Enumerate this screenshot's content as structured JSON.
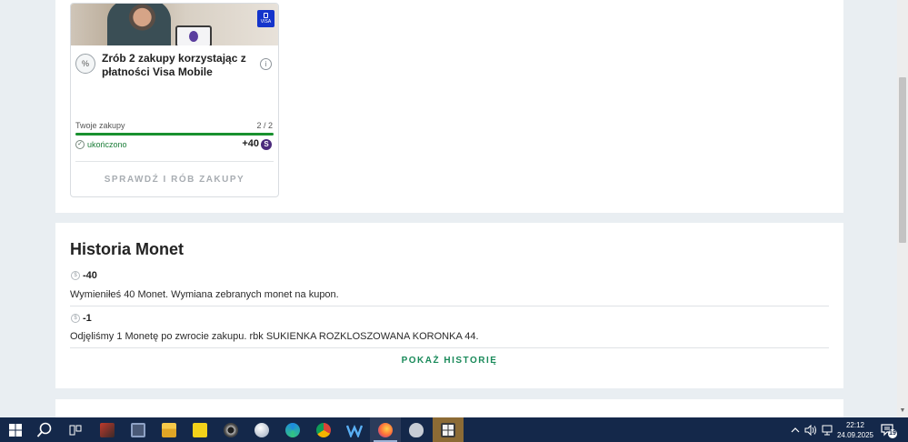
{
  "offer_card": {
    "title": "Zrób 2 zakupy korzystając z płatności Visa Mobile",
    "badge_text": "VISA",
    "percent_icon": "%",
    "info_icon": "i",
    "progress_label": "Twoje zakupy",
    "progress_count": "2 / 2",
    "progress_fraction": 1.0,
    "status_text": "ukończono",
    "reward": "+40",
    "coin_symbol": "S",
    "cta_label": "SPRAWDŹ I RÓB ZAKUPY",
    "colors": {
      "progress": "#19912f",
      "status": "#1b7d38",
      "coin": "#4b2a7c",
      "visa": "#1434cb"
    }
  },
  "history": {
    "title": "Historia Monet",
    "entries": [
      {
        "amount": "-40",
        "description": "Wymieniłeś 40 Monet. Wymiana zebranych monet na kupon."
      },
      {
        "amount": "-1",
        "description": "Odjęliśmy 1 Monetę po zwrocie zakupu. rbk SUKIENKA ROZKLOSZOWANA KORONKA 44."
      }
    ],
    "more_label": "POKAŻ HISTORIĘ",
    "colors": {
      "more": "#1a8a5a"
    }
  },
  "taskbar": {
    "apps": [
      {
        "name": "task-view-icon"
      },
      {
        "name": "app-icon-red"
      },
      {
        "name": "calculator-icon"
      },
      {
        "name": "file-explorer-icon"
      },
      {
        "name": "sticky-notes-icon"
      },
      {
        "name": "settings-icon"
      },
      {
        "name": "app-icon-sphere"
      },
      {
        "name": "edge-icon"
      },
      {
        "name": "chrome-icon"
      },
      {
        "name": "wps-icon"
      },
      {
        "name": "firefox-icon"
      },
      {
        "name": "app-icon-shield"
      },
      {
        "name": "app-icon-crest"
      }
    ],
    "time": "22:12",
    "date": "24.09.2025",
    "notification_count": "19"
  }
}
